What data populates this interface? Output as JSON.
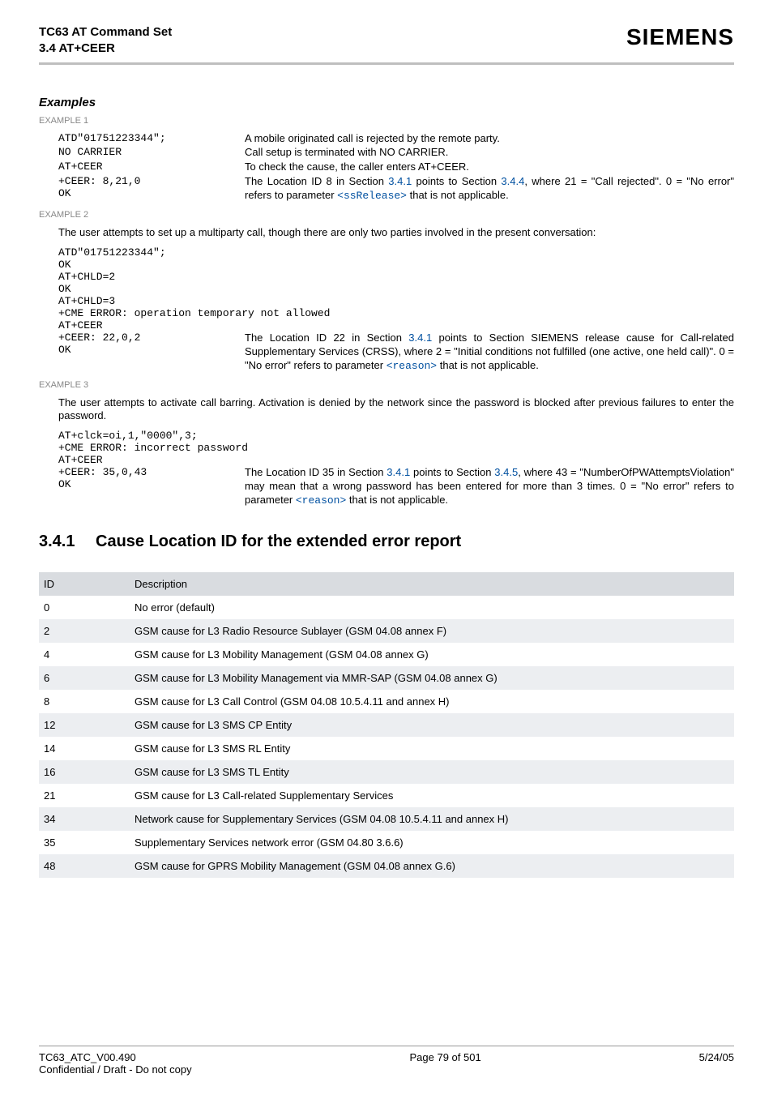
{
  "header": {
    "title_line1": "TC63 AT Command Set",
    "title_line2": "3.4 AT+CEER",
    "brand": "SIEMENS"
  },
  "examples_title": "Examples",
  "ex1": {
    "label": "EXAMPLE 1",
    "cmd1": "ATD\"01751223344\";",
    "desc1": "A mobile originated call is rejected by the remote party.",
    "cmd2": "NO CARRIER",
    "desc2": "Call setup is terminated with NO CARRIER.",
    "cmd3": "AT+CEER",
    "desc3": "To check the cause, the caller enters AT+CEER.",
    "cmd4": "+CEER: 8,21,0",
    "cmd5": "OK",
    "desc4_p1": "The Location ID 8 in Section ",
    "desc4_link1": "3.4.1",
    "desc4_p2": " points to Section ",
    "desc4_link2": "3.4.4",
    "desc4_p3": ", where 21 = \"Call rejected\". 0 = \"No error\" refers to parameter ",
    "desc4_link3": "<ssRelease>",
    "desc4_p4": " that is not applicable."
  },
  "ex2": {
    "label": "EXAMPLE 2",
    "intro": "The user attempts to set up a multiparty call, though there are only two parties involved in the present conversation:",
    "cmds": "ATD\"01751223344\";\nOK\nAT+CHLD=2\nOK\nAT+CHLD=3\n+CME ERROR: operation temporary not allowed\nAT+CEER",
    "cmd_last1": "+CEER: 22,0,2",
    "cmd_last2": "OK",
    "desc_p1": "The Location ID 22 in Section ",
    "desc_link1": "3.4.1",
    "desc_p2": " points to Section SIEMENS release cause for Call-related Supplementary Services (CRSS), where 2 = \"Initial conditions not fulfilled (one active, one held call)\". 0 = \"No error\" refers to parameter ",
    "desc_link2": "<reason>",
    "desc_p3": " that is not applicable."
  },
  "ex3": {
    "label": "EXAMPLE 3",
    "intro": "The user attempts to activate call barring. Activation is denied by the network since the password is blocked after previous failures to enter the password.",
    "cmds": "AT+clck=oi,1,\"0000\",3;\n+CME ERROR: incorrect password\nAT+CEER",
    "cmd_last1": "+CEER: 35,0,43",
    "cmd_last2": "OK",
    "desc_p1": "The Location ID 35 in Section ",
    "desc_link1": "3.4.1",
    "desc_p2": " points to Section ",
    "desc_link2": "3.4.5",
    "desc_p3": ", where 43 = \"NumberOfPWAttemptsViolation\" may mean that a wrong password has been entered for more than 3 times. 0 = \"No error\" refers to parameter ",
    "desc_link3": "<reason>",
    "desc_p4": " that is not applicable."
  },
  "section": {
    "number": "3.4.1",
    "title": "Cause Location ID for the extended error report"
  },
  "table": {
    "head_id": "ID",
    "head_desc": "Description",
    "rows": [
      {
        "id": "0",
        "desc": "No error (default)"
      },
      {
        "id": "2",
        "desc": "GSM cause for L3 Radio Resource Sublayer (GSM 04.08 annex F)"
      },
      {
        "id": "4",
        "desc": "GSM cause for L3 Mobility Management (GSM 04.08 annex G)"
      },
      {
        "id": "6",
        "desc": "GSM cause for L3 Mobility Management via MMR-SAP (GSM 04.08 annex G)"
      },
      {
        "id": "8",
        "desc": "GSM cause for L3 Call Control (GSM 04.08 10.5.4.11 and annex H)"
      },
      {
        "id": "12",
        "desc": "GSM cause for L3 SMS CP Entity"
      },
      {
        "id": "14",
        "desc": "GSM cause for L3 SMS RL Entity"
      },
      {
        "id": "16",
        "desc": "GSM cause for L3 SMS TL Entity"
      },
      {
        "id": "21",
        "desc": "GSM cause for L3 Call-related Supplementary Services"
      },
      {
        "id": "34",
        "desc": "Network cause for Supplementary Services (GSM 04.08 10.5.4.11 and annex H)"
      },
      {
        "id": "35",
        "desc": "Supplementary Services network error (GSM 04.80 3.6.6)"
      },
      {
        "id": "48",
        "desc": "GSM cause for GPRS Mobility Management (GSM 04.08 annex G.6)"
      }
    ]
  },
  "footer": {
    "left_line1": "TC63_ATC_V00.490",
    "left_line2": "Confidential / Draft - Do not copy",
    "center": "Page 79 of 501",
    "right": "5/24/05"
  }
}
